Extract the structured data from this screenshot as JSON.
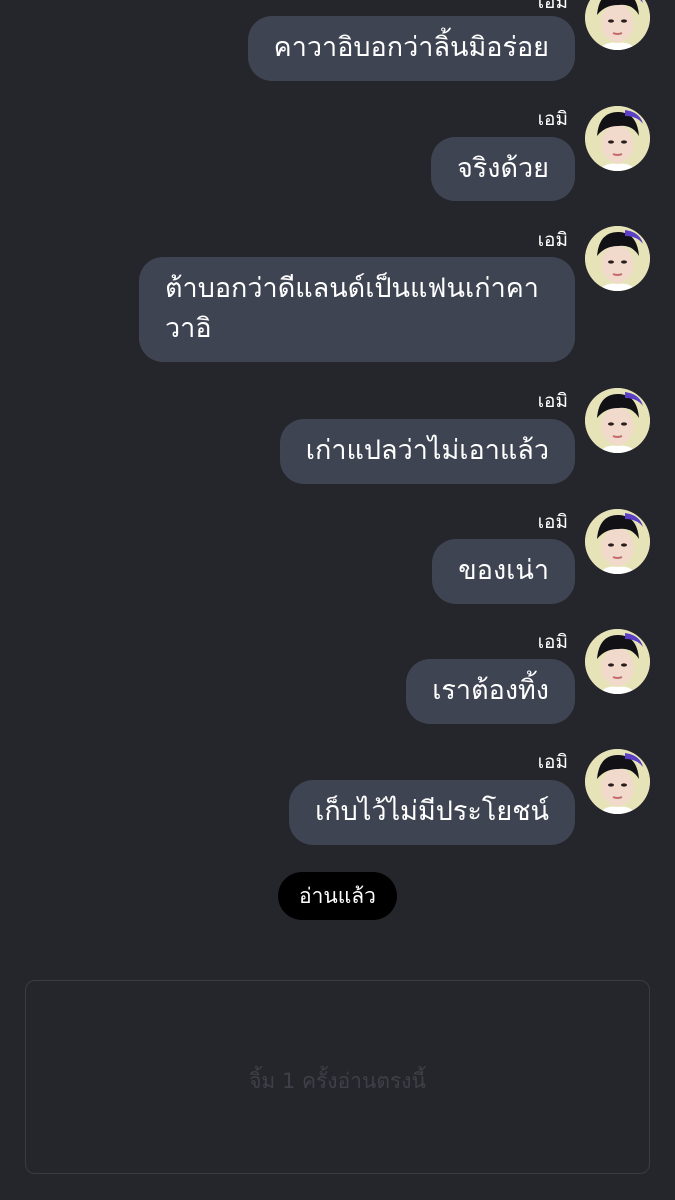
{
  "messages": [
    {
      "sender": "เอมิ",
      "text": "คาวาอิบอกว่าลิ้นมิอร่อย"
    },
    {
      "sender": "เอมิ",
      "text": "จริงด้วย"
    },
    {
      "sender": "เอมิ",
      "text": "ต้าบอกว่าดีแลนด์เป็นแฟนเก่าคาวาอิ"
    },
    {
      "sender": "เอมิ",
      "text": "เก่าแปลว่าไม่เอาแล้ว"
    },
    {
      "sender": "เอมิ",
      "text": "ของเน่า"
    },
    {
      "sender": "เอมิ",
      "text": "เราต้องทิ้ง"
    },
    {
      "sender": "เอมิ",
      "text": "เก็บไว้ไม่มีประโยชน์"
    }
  ],
  "read_label": "อ่านแล้ว",
  "tap_hint": "จิ้ม 1 ครั้งอ่านตรงนี้",
  "colors": {
    "background": "#25262b",
    "bubble": "#3e4452",
    "read_pill": "#000000",
    "avatar_bg": "#e7e3b8"
  }
}
